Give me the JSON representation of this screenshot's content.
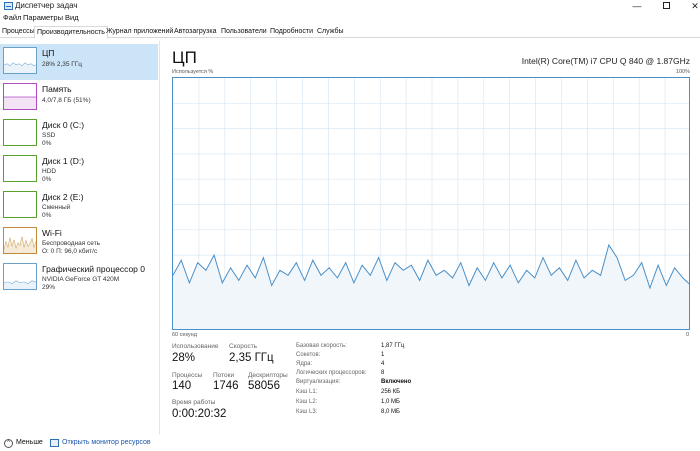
{
  "window": {
    "title": "Диспетчер задач",
    "controls": {
      "minimize": "—",
      "maximize": "",
      "close": "✕"
    }
  },
  "menu": [
    "Файл",
    "Параметры",
    "Вид"
  ],
  "tabs": [
    {
      "label": "Процессы",
      "active": false
    },
    {
      "label": "Производительность",
      "active": true
    },
    {
      "label": "Журнал приложений",
      "active": false
    },
    {
      "label": "Автозагрузка",
      "active": false
    },
    {
      "label": "Пользователи",
      "active": false
    },
    {
      "label": "Подробности",
      "active": false
    },
    {
      "label": "Службы",
      "active": false
    }
  ],
  "sidebar": {
    "items": [
      {
        "title": "ЦП",
        "lines": [
          "28% 2,35 ГГц"
        ],
        "selected": true,
        "color": "#4a90c8"
      },
      {
        "title": "Память",
        "lines": [
          "4,0/7,8 ГБ (51%)"
        ],
        "selected": false,
        "color": "#b04cc0"
      },
      {
        "title": "Диск 0 (C:)",
        "lines": [
          "SSD",
          "0%"
        ],
        "selected": false,
        "color": "#5aa02c"
      },
      {
        "title": "Диск 1 (D:)",
        "lines": [
          "HDD",
          "0%"
        ],
        "selected": false,
        "color": "#5aa02c"
      },
      {
        "title": "Диск 2 (E:)",
        "lines": [
          "Сменный",
          "0%"
        ],
        "selected": false,
        "color": "#5aa02c"
      },
      {
        "title": "Wi-Fi",
        "lines": [
          "Беспроводная сеть",
          "О: 0 П: 96,0 кбит/с"
        ],
        "selected": false,
        "color": "#c08a3a"
      },
      {
        "title": "Графический процессор 0",
        "lines": [
          "NVIDIA GeForce GT 420M",
          "29%"
        ],
        "selected": false,
        "color": "#4a90c8"
      }
    ]
  },
  "main": {
    "title": "ЦП",
    "cpu_model": "Intel(R) Core(TM) i7 CPU Q 840 @ 1.87GHz",
    "graph": {
      "y_label": "Используется %",
      "y_max_label": "100%",
      "x_left_label": "60 секунд",
      "x_right_label": "0",
      "line_color": "#4a90c8",
      "fill_color": "#f1f6fb",
      "grid_color": "#d9e7f3",
      "values": [
        22,
        28,
        19,
        27,
        24,
        30,
        19,
        25,
        20,
        26,
        21,
        29,
        18,
        24,
        22,
        27,
        20,
        28,
        22,
        25,
        21,
        27,
        19,
        26,
        22,
        29,
        20,
        27,
        24,
        26,
        20,
        28,
        22,
        24,
        21,
        27,
        18,
        25,
        20,
        27,
        21,
        26,
        19,
        24,
        21,
        29,
        22,
        25,
        20,
        28,
        21,
        24,
        22,
        34,
        29,
        20,
        22,
        27,
        17,
        26,
        18,
        25,
        21,
        18
      ]
    },
    "stats": {
      "usage_label": "Использование",
      "usage_value": "28%",
      "speed_label": "Скорость",
      "speed_value": "2,35 ГГц",
      "processes_label": "Процессы",
      "processes_value": "140",
      "threads_label": "Потоки",
      "threads_value": "1746",
      "handles_label": "Дескрипторы",
      "handles_value": "58056",
      "uptime_label": "Время работы",
      "uptime_value": "0:00:20:32"
    },
    "specs": [
      {
        "label": "Базовая скорость:",
        "value": "1,87 ГГц"
      },
      {
        "label": "Сокетов:",
        "value": "1"
      },
      {
        "label": "Ядра:",
        "value": "4"
      },
      {
        "label": "Логических процессоров:",
        "value": "8"
      },
      {
        "label": "Виртуализация:",
        "value": "Включено"
      },
      {
        "label": "Кэш L1:",
        "value": "256 КБ"
      },
      {
        "label": "Кэш L2:",
        "value": "1,0 МБ"
      },
      {
        "label": "Кэш L3:",
        "value": "8,0 МБ"
      }
    ]
  },
  "footer": {
    "fewer_details": "Меньше",
    "open_monitor": "Открыть монитор ресурсов"
  }
}
